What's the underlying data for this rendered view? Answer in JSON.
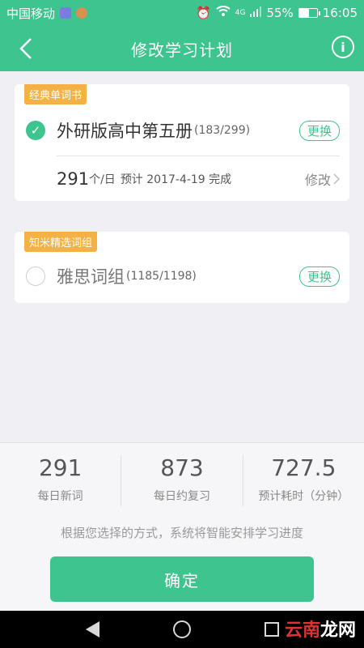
{
  "status_bar": {
    "carrier": "中国移动",
    "signal_type": "4G",
    "battery_text": "55%",
    "battery_level": 0.55,
    "time": "16:05"
  },
  "appbar": {
    "title": "修改学习计划",
    "info_symbol": "i"
  },
  "card_classic": {
    "tag": "经典单词书",
    "book_name": "外研版高中第五册",
    "book_count": "(183/299)",
    "change_label": "更换",
    "plan_number": "291",
    "plan_unit": "个/日",
    "plan_text": "预计 2017-4-19 完成",
    "edit_label": "修改"
  },
  "card_phrase": {
    "tag": "知米精选词组",
    "book_name": "雅思词组",
    "book_count": "(1185/1198)",
    "change_label": "更换"
  },
  "stats": [
    {
      "value": "291",
      "label": "每日新词"
    },
    {
      "value": "873",
      "label": "每日约复习"
    },
    {
      "value": "727.5",
      "label": "预计耗时（分钟）"
    }
  ],
  "hint": "根据您选择的方式，系统将智能安排学习进度",
  "confirm_label": "确定",
  "watermark": {
    "red": "云南",
    "white": "龙网"
  },
  "colors": {
    "accent": "#3ec48f",
    "tag": "#f4b246"
  }
}
